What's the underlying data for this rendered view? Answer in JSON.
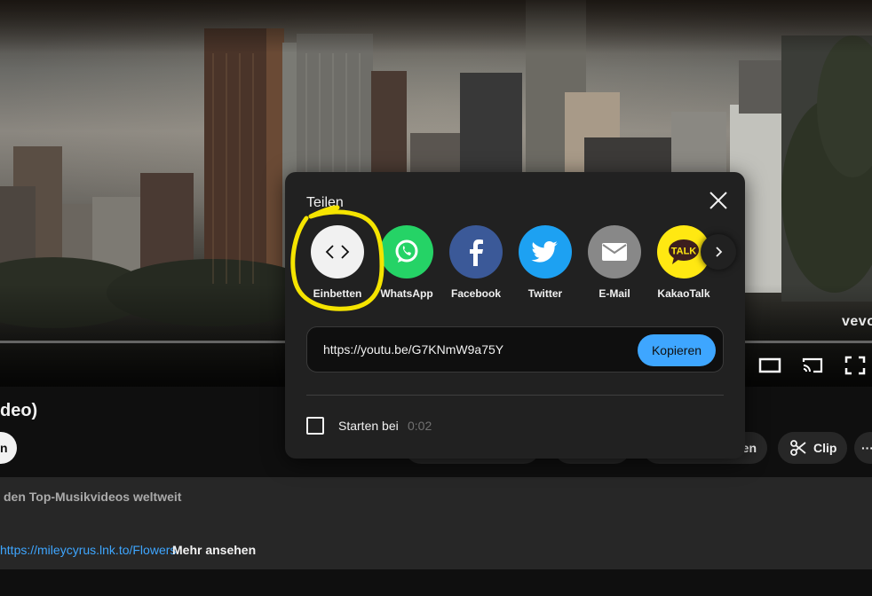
{
  "video": {
    "watermark": "vevo"
  },
  "page": {
    "title_fragment": "deo)",
    "pill_white_label": "n",
    "pill_save_label": "en",
    "clip_label": "Clip",
    "more_label": "···",
    "description": {
      "line1": "den Top-Musikvideos weltweit",
      "link": "https://mileycyrus.lnk.to/Flowers",
      "more": "Mehr ansehen"
    }
  },
  "share_dialog": {
    "title": "Teilen",
    "targets": [
      {
        "label": "Einbetten",
        "icon": "embed-code-icon",
        "color": "#f1f1f1"
      },
      {
        "label": "WhatsApp",
        "icon": "whatsapp-icon",
        "color": "#25d366"
      },
      {
        "label": "Facebook",
        "icon": "facebook-icon",
        "color": "#3b5998"
      },
      {
        "label": "Twitter",
        "icon": "twitter-bird-icon",
        "color": "#1da1f2"
      },
      {
        "label": "E-Mail",
        "icon": "email-envelope-icon",
        "color": "#888888"
      },
      {
        "label": "KakaoTalk",
        "icon": "kakaotalk-icon",
        "color": "#ffe812"
      }
    ],
    "kakao_badge": "TALK",
    "url": "https://youtu.be/G7KNmW9a75Y",
    "copy_label": "Kopieren",
    "start_at_label": "Starten bei",
    "start_at_time": "0:02",
    "start_at_checked": false
  },
  "colors": {
    "accent_blue": "#3ea6ff",
    "annotation_yellow": "#f5e400",
    "dialog_bg": "#212121"
  }
}
